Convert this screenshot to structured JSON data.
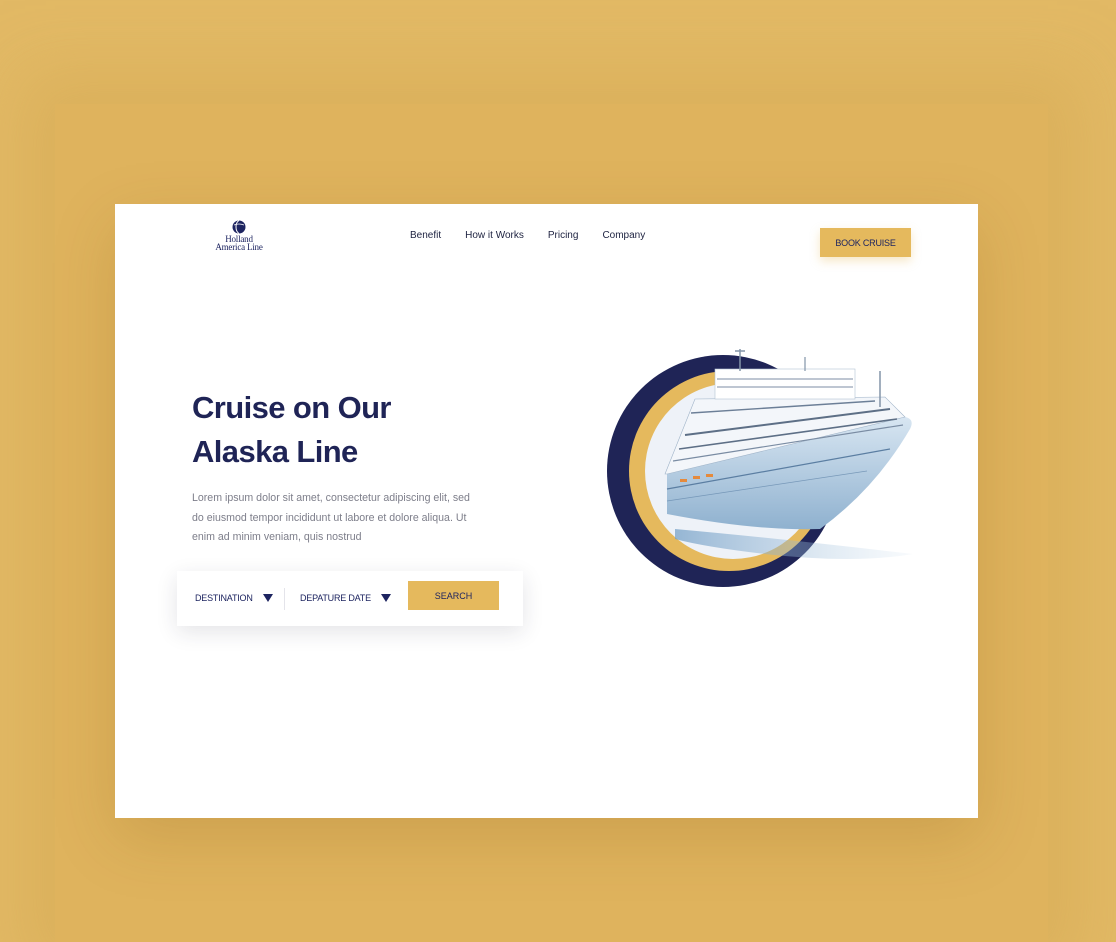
{
  "logo": {
    "line1": "Holland",
    "line2": "America Line"
  },
  "nav": {
    "items": [
      {
        "label": "Benefit"
      },
      {
        "label": "How it Works"
      },
      {
        "label": "Pricing"
      },
      {
        "label": "Company"
      }
    ]
  },
  "header": {
    "cta_label": "BOOK CRUISE"
  },
  "hero": {
    "title_line1": "Cruise on Our",
    "title_line2": "Alaska Line",
    "description": "Lorem ipsum dolor sit amet, consectetur adipiscing elit, sed do eiusmod tempor incididunt ut labore et dolore aliqua. Ut enim ad minim veniam, quis nostrud"
  },
  "search": {
    "destination_label": "DESTINATION",
    "date_label": "DEPATURE DATE",
    "button_label": "SEARCH"
  },
  "colors": {
    "background": "#e2b965",
    "accent": "#e5b95d",
    "navy": "#1f2456",
    "text_muted": "#7d7e8a"
  },
  "icons": {
    "logo": "globe-logo-icon",
    "dropdown": "triangle-down-icon",
    "hero_image": "cruise-ship-image"
  }
}
